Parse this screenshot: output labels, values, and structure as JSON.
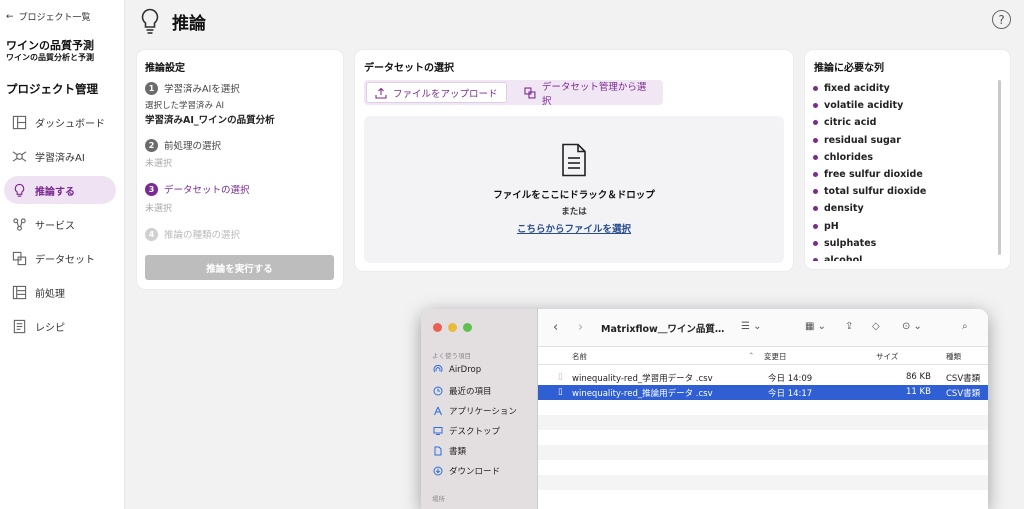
{
  "sidebar": {
    "back_label": "プロジェクト一覧",
    "project_title": "ワインの品質予測",
    "project_subtitle": "ワインの品質分析と予測",
    "section_heading": "プロジェクト管理",
    "items": [
      {
        "label": "ダッシュボード",
        "icon": "dashboard-icon"
      },
      {
        "label": "学習済みAI",
        "icon": "ai-model-icon"
      },
      {
        "label": "推論する",
        "icon": "lightbulb-icon",
        "active": true
      },
      {
        "label": "サービス",
        "icon": "service-icon"
      },
      {
        "label": "データセット",
        "icon": "dataset-icon"
      },
      {
        "label": "前処理",
        "icon": "preprocess-icon"
      },
      {
        "label": "レシピ",
        "icon": "recipe-icon"
      }
    ]
  },
  "header": {
    "title": "推論",
    "help": "?"
  },
  "settings": {
    "title": "推論設定",
    "step1": {
      "num": "1",
      "label": "学習済みAIを選択",
      "selected_caption": "選択した学習済み AI",
      "selected_value": "学習済みAI_ワインの品質分析"
    },
    "step2": {
      "num": "2",
      "label": "前処理の選択",
      "status": "未選択"
    },
    "step3": {
      "num": "3",
      "label": "データセットの選択",
      "status": "未選択"
    },
    "step4": {
      "num": "4",
      "label": "推論の種類の選択"
    },
    "run_button": "推論を実行する"
  },
  "dataset": {
    "title": "データセットの選択",
    "tab_upload": "ファイルをアップロード",
    "tab_manage": "データセット管理から選択",
    "drop_text": "ファイルをここにドラック＆ドロップ",
    "or_text": "または",
    "select_link": "こちらからファイルを選択"
  },
  "required": {
    "title": "推論に必要な列",
    "columns": [
      "fixed acidity",
      "volatile acidity",
      "citric acid",
      "residual sugar",
      "chlorides",
      "free sulfur dioxide",
      "total sulfur dioxide",
      "density",
      "pH",
      "sulphates",
      "alcohol"
    ]
  },
  "finder": {
    "favorites_label": "よく使う項目",
    "places_label": "場所",
    "sidebar_items": [
      {
        "label": "AirDrop",
        "icon": "airdrop-icon"
      },
      {
        "label": "最近の項目",
        "icon": "clock-icon"
      },
      {
        "label": "アプリケーション",
        "icon": "applications-icon"
      },
      {
        "label": "デスクトップ",
        "icon": "desktop-icon"
      },
      {
        "label": "書類",
        "icon": "document-icon"
      },
      {
        "label": "ダウンロード",
        "icon": "download-icon"
      }
    ],
    "path": "Matrixflow＿ワイン品質…",
    "columns": {
      "name": "名前",
      "modified": "変更日",
      "size": "サイズ",
      "kind": "種類"
    },
    "files": [
      {
        "name": "winequality-red_学習用データ .csv",
        "modified": "今日 14:09",
        "size": "86 KB",
        "kind": "CSV書類",
        "selected": false
      },
      {
        "name": "winequality-red_推論用データ .csv",
        "modified": "今日 14:17",
        "size": "11 KB",
        "kind": "CSV書類",
        "selected": true
      }
    ]
  },
  "colors": {
    "accent": "#7a2a90",
    "accent_bg": "#efe3f3",
    "selection": "#2f5fd3",
    "link": "#2a4d8f"
  }
}
